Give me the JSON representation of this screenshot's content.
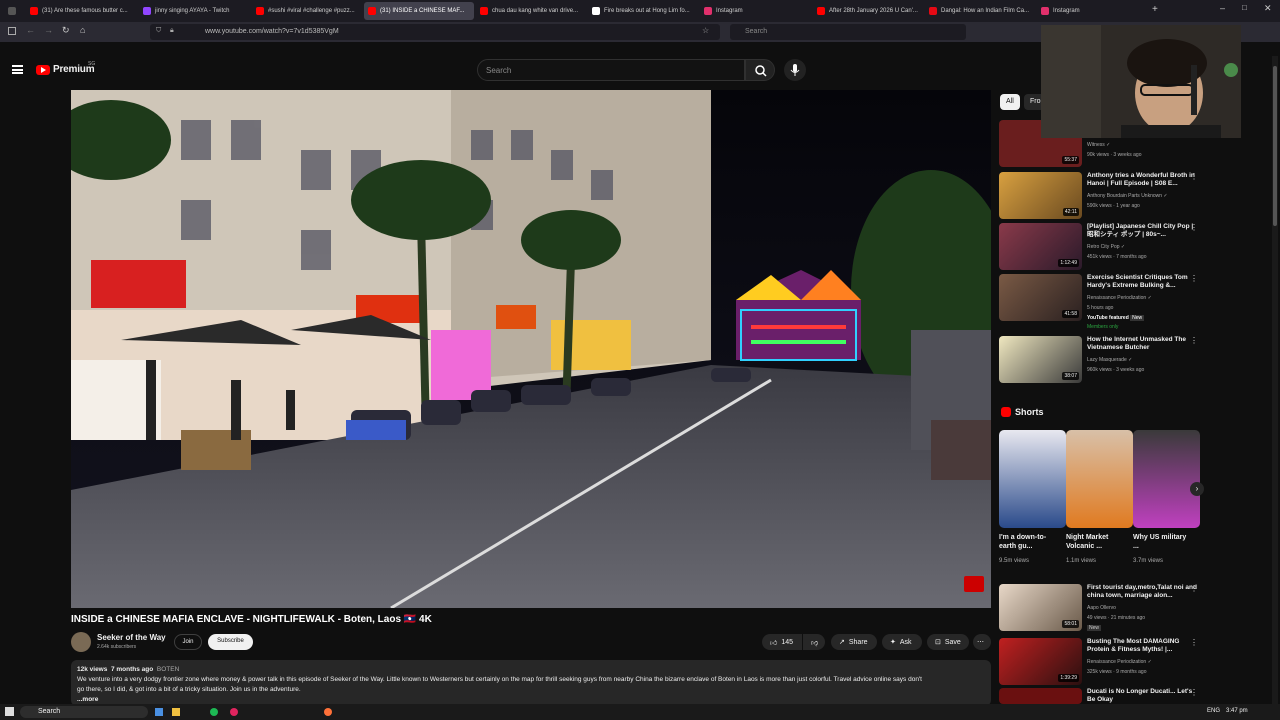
{
  "browser": {
    "tabs": [
      {
        "label": "(31) Are these famous butter c...",
        "color": "#ff0000"
      },
      {
        "label": "jinny singing AYAYA - Twitch",
        "color": "#9146ff"
      },
      {
        "label": "#sushi #viral #challenge #puzz...",
        "color": "#ff0000"
      },
      {
        "label": "(31) INSIDE a CHINESE MAF...",
        "color": "#ff0000"
      },
      {
        "label": "chua dau kang white van drive...",
        "color": "#ff0000"
      },
      {
        "label": "Fire breaks out at Hong Lim fo...",
        "color": "#ffffff"
      },
      {
        "label": "Instagram",
        "color": "#e1306c"
      },
      {
        "label": "After 28th January 2026 U Can'...",
        "color": "#ff0000"
      },
      {
        "label": "Dangal: How an Indian Film Ca...",
        "color": "#e50914"
      },
      {
        "label": "Instagram",
        "color": "#e1306c"
      }
    ],
    "url": "www.youtube.com/watch?v=7v1d5385VgM",
    "search_placeholder": "Search"
  },
  "header": {
    "logo": "Premium",
    "region": "SG",
    "search_placeholder": "Search"
  },
  "video": {
    "title": "INSIDE a CHINESE MAFIA ENCLAVE - NIGHTLIFEWALK - Boten, Laos 🇱🇦 4K",
    "channel": "Seeker of the Way",
    "subscribers": "2.64k subscribers",
    "join": "Join",
    "subscribe": "Subscribe",
    "likes": "145",
    "share": "Share",
    "ask": "Ask",
    "save": "Save",
    "views": "12k views",
    "age": "7 months ago",
    "tag": "BOTEN",
    "description_1": "We venture into a very dodgy frontier zone where money & power talk in this episode of Seeker of the Way. Little known to Westerners but certainly on the map for thrill seeking guys from nearby China the bizarre enclave of Boten in Laos is more than just colorful. Travel advice online says don't",
    "description_2": "go there, so I did, & got into a bit of a tricky situation. Join us in the adventure.",
    "more": "...more"
  },
  "sidebar": {
    "chips": [
      "All",
      "From"
    ],
    "recs": [
      {
        "title": "",
        "channel": "Witness ✓",
        "views": "90k views · 3 weeks ago",
        "duration": "55:37",
        "color": "#6a1e1e"
      },
      {
        "title": "Anthony tries a Wonderful Broth in Hanoi | Full Episode | S08 E...",
        "channel": "Anthony Bourdain Parts Unknown ✓",
        "views": "590k views · 1 year ago",
        "duration": "42:11",
        "color": "#b7852e"
      },
      {
        "title": "[Playlist] Japanese Chill City Pop | 昭和シティ ポップ | 80s~...",
        "channel": "Retro City Pop ✓",
        "views": "451k views · 7 months ago",
        "duration": "1:12:49",
        "color": "#7a4a55"
      },
      {
        "title": "Exercise Scientist Critiques Tom Hardy's Extreme Bulking &...",
        "channel": "Renaissance Periodization ✓",
        "views": "5 hours ago",
        "duration": "41:58",
        "color": "#5a4035",
        "featured": "YouTube featured",
        "new": "New",
        "members": "Members only"
      },
      {
        "title": "How the Internet Unmasked The Vietnamese Butcher",
        "channel": "Lazy Masquerade ✓",
        "views": "960k views · 3 weeks ago",
        "duration": "38:07",
        "color": "#3a3a3a"
      },
      {
        "title": "First tourist day,metro,Talat noi and china town, marriage alon...",
        "channel": "Aapo Ollervo",
        "views": "49 views · 21 minutes ago",
        "duration": "58:01",
        "color": "#8a7a6a",
        "new": "New"
      },
      {
        "title": "Busting The Most DAMAGING Protein & Fitness Myths! |...",
        "channel": "Renaissance Periodization ✓",
        "views": "325k views · 9 months ago",
        "duration": "1:39:29",
        "color": "#6a2020"
      },
      {
        "title": "Ducati is No Longer Ducati... Let's Be Okay",
        "channel": "",
        "views": "",
        "duration": "",
        "color": "#6a1010"
      }
    ],
    "shorts_title": "Shorts",
    "shorts": [
      {
        "title": "I'm a down-to-earth gu...",
        "views": "9.5m views",
        "color": "#3a5a8a"
      },
      {
        "title": "Night Market Volcanic ...",
        "views": "1.1m views",
        "color": "#c47a2a"
      },
      {
        "title": "Why US military ...",
        "views": "3.7m views",
        "color": "#5a3a8a"
      }
    ]
  },
  "taskbar": {
    "search": "Search",
    "lang": "ENG",
    "time": "3:47 pm"
  }
}
